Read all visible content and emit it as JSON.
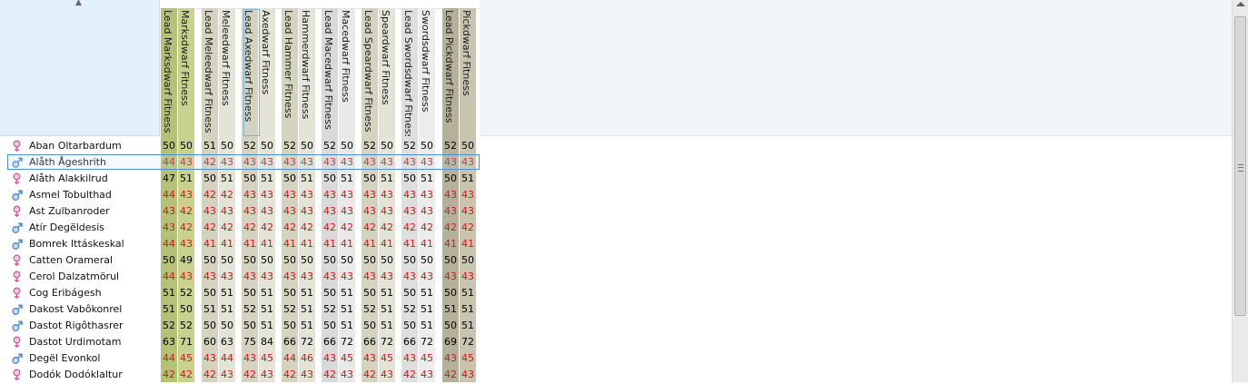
{
  "colors": {
    "good": "#000000",
    "bad": "#c8191c",
    "header_bg": "#e3f1fb",
    "selection": "#4a90c8"
  },
  "columns": [
    {
      "label": "Lead Marksdwarf Fitness",
      "bg": "#b5c177"
    },
    {
      "label": "Marksdwarf Fitness",
      "bg": "#c9d18e"
    },
    {
      "label": "Lead Meleedwarf Fitness",
      "bg": "#d3d3c0"
    },
    {
      "label": "Meleedwarf Fitness",
      "bg": "#e3e3d8"
    },
    {
      "label": "Lead Axedwarf Fitness",
      "bg": "#d3d3c0"
    },
    {
      "label": "Axedwarf Fitness",
      "bg": "#e3e3d8"
    },
    {
      "label": "Lead Hammer Fitness",
      "bg": "#d3d3c0"
    },
    {
      "label": "Hammerdwarf Fitness",
      "bg": "#e3e3d8"
    },
    {
      "label": "Lead Macedwarf Fitness",
      "bg": "#d9d9d9"
    },
    {
      "label": "Macedwarf Fitness",
      "bg": "#e9e9e9"
    },
    {
      "label": "Lead Speardwarf Fitness",
      "bg": "#d3d3c0"
    },
    {
      "label": "Speardwarf Fitness",
      "bg": "#e3e3d8"
    },
    {
      "label": "Lead Swordsdwarf Fitness",
      "bg": "#dedede"
    },
    {
      "label": "Swordsdwarf Fitness",
      "bg": "#ececec"
    },
    {
      "label": "Lead Pickdwarf Fitness",
      "bg": "#b4b09a"
    },
    {
      "label": "Pickdwarf Fitness",
      "bg": "#c8c4b0"
    }
  ],
  "rows": [
    {
      "name": "Aban Oltarbardum",
      "gender": "female",
      "values": [
        50,
        50,
        51,
        50,
        52,
        50,
        52,
        50,
        52,
        50,
        52,
        50,
        52,
        50,
        52,
        50
      ]
    },
    {
      "name": "Alåth Ågeshrith",
      "gender": "male",
      "values": [
        44,
        43,
        42,
        43,
        43,
        43,
        43,
        43,
        43,
        43,
        43,
        43,
        43,
        43,
        43,
        43
      ]
    },
    {
      "name": "Alåth Alakkilrud",
      "gender": "female",
      "values": [
        47,
        51,
        50,
        51,
        50,
        51,
        50,
        51,
        50,
        51,
        50,
        51,
        50,
        51,
        50,
        51
      ]
    },
    {
      "name": "Asmel Tobulthad",
      "gender": "male",
      "values": [
        44,
        43,
        42,
        42,
        43,
        43,
        43,
        43,
        43,
        43,
        43,
        43,
        43,
        43,
        43,
        43
      ]
    },
    {
      "name": "Ast Zulbanroder",
      "gender": "female",
      "values": [
        43,
        42,
        43,
        43,
        43,
        43,
        43,
        43,
        43,
        43,
        43,
        43,
        43,
        43,
        43,
        43
      ]
    },
    {
      "name": "Atír Degëldesis",
      "gender": "male",
      "values": [
        43,
        42,
        42,
        42,
        42,
        42,
        42,
        42,
        42,
        42,
        42,
        42,
        42,
        42,
        42,
        42
      ]
    },
    {
      "name": "Bomrek Ittáskeskal",
      "gender": "male",
      "values": [
        44,
        43,
        41,
        41,
        41,
        41,
        41,
        41,
        41,
        41,
        41,
        41,
        41,
        41,
        41,
        41
      ]
    },
    {
      "name": "Catten Orameral",
      "gender": "female",
      "values": [
        50,
        49,
        50,
        50,
        50,
        50,
        50,
        50,
        50,
        50,
        50,
        50,
        50,
        50,
        50,
        50
      ]
    },
    {
      "name": "Cerol Dalzatmörul",
      "gender": "female",
      "values": [
        44,
        43,
        43,
        43,
        43,
        43,
        43,
        43,
        43,
        43,
        43,
        43,
        43,
        43,
        43,
        43
      ]
    },
    {
      "name": "Cog Eribágesh",
      "gender": "female",
      "values": [
        51,
        52,
        50,
        51,
        50,
        51,
        50,
        51,
        50,
        51,
        50,
        51,
        50,
        51,
        50,
        51
      ]
    },
    {
      "name": "Dakost Vabôkonrel",
      "gender": "male",
      "values": [
        51,
        50,
        51,
        51,
        52,
        51,
        52,
        51,
        52,
        51,
        52,
        51,
        52,
        51,
        51,
        51
      ]
    },
    {
      "name": "Dastot Rigôthasrer",
      "gender": "male",
      "values": [
        52,
        52,
        50,
        50,
        50,
        51,
        50,
        51,
        50,
        51,
        50,
        51,
        50,
        51,
        50,
        51
      ]
    },
    {
      "name": "Dastot Urdimotam",
      "gender": "female",
      "values": [
        63,
        71,
        60,
        63,
        75,
        84,
        66,
        72,
        66,
        72,
        66,
        72,
        66,
        72,
        69,
        72
      ]
    },
    {
      "name": "Degël Evonkol",
      "gender": "male",
      "values": [
        44,
        45,
        43,
        44,
        43,
        45,
        44,
        46,
        43,
        45,
        43,
        45,
        43,
        45,
        43,
        45
      ]
    },
    {
      "name": "Dodók Dodóklaltur",
      "gender": "female",
      "values": [
        42,
        42,
        42,
        43,
        42,
        43,
        42,
        43,
        42,
        43,
        42,
        43,
        42,
        43,
        42,
        43
      ]
    }
  ]
}
